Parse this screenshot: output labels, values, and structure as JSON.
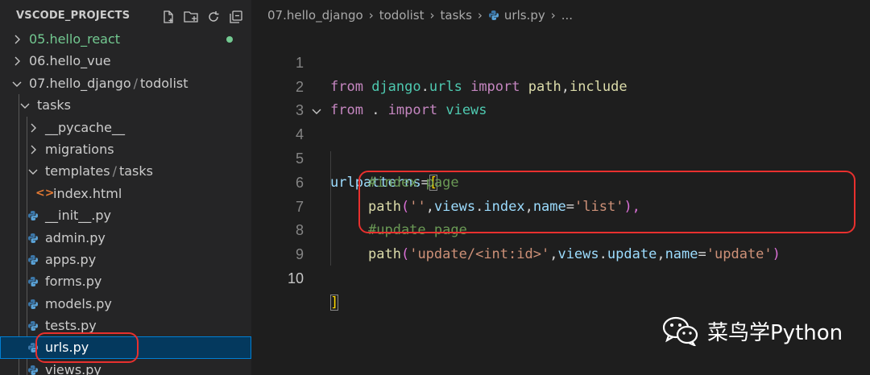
{
  "explorer": {
    "title": "VSCODE_PROJECTS",
    "actions": [
      "new-file-icon",
      "new-folder-icon",
      "refresh-icon",
      "collapse-all-icon"
    ],
    "items": [
      {
        "label": "05.hello_react",
        "icon": "chevron-right-icon",
        "modified": true
      },
      {
        "label": "06.hello_vue",
        "icon": "chevron-right-icon"
      },
      {
        "label_parts": [
          "07.hello_django",
          "/",
          "todolist"
        ],
        "icon": "chevron-down-icon"
      },
      {
        "label": "tasks",
        "icon": "chevron-down-icon"
      },
      {
        "label": "__pycache__",
        "icon": "chevron-right-icon"
      },
      {
        "label": "migrations",
        "icon": "chevron-right-icon"
      },
      {
        "label_parts": [
          "templates",
          "/",
          "tasks"
        ],
        "icon": "chevron-down-icon"
      },
      {
        "label": "index.html",
        "icon": "html-file-icon"
      },
      {
        "label": "__init__.py",
        "icon": "python-file-icon"
      },
      {
        "label": "admin.py",
        "icon": "python-file-icon"
      },
      {
        "label": "apps.py",
        "icon": "python-file-icon"
      },
      {
        "label": "forms.py",
        "icon": "python-file-icon"
      },
      {
        "label": "models.py",
        "icon": "python-file-icon"
      },
      {
        "label": "tests.py",
        "icon": "python-file-icon"
      },
      {
        "label": "urls.py",
        "icon": "python-file-icon",
        "selected": true
      },
      {
        "label": "views.py",
        "icon": "python-file-icon"
      }
    ]
  },
  "breadcrumb": [
    "07.hello_django",
    "todolist",
    "tasks",
    "urls.py",
    "..."
  ],
  "editor": {
    "line_numbers": [
      "1",
      "2",
      "3",
      "4",
      "5",
      "6",
      "7",
      "8",
      "9",
      "10"
    ],
    "lines": {
      "l1": [
        "from",
        " ",
        "django",
        ".",
        "urls",
        " ",
        "import",
        " ",
        "path",
        ",",
        "include"
      ],
      "l2": [
        "from",
        " . ",
        "import",
        " ",
        "views"
      ],
      "l4": [
        "urlpatterns",
        "=",
        "["
      ],
      "l5": [
        "#index page"
      ],
      "l6": [
        "path",
        "(",
        "''",
        ",",
        "views",
        ".",
        "index",
        ",",
        "name",
        "=",
        "'list'",
        "),"
      ],
      "l7": [
        "#update page"
      ],
      "l8": [
        "path",
        "(",
        "'update/<int:id>'",
        ",",
        "views",
        ".",
        "update",
        ",",
        "name",
        "=",
        "'update'",
        ")"
      ],
      "l10": [
        "]"
      ]
    }
  },
  "watermark": {
    "text": "菜鸟学Python",
    "icon": "wechat-icon"
  },
  "colors": {
    "highlight": "#e8302e",
    "selection": "#04395e",
    "modified": "#73c991"
  }
}
